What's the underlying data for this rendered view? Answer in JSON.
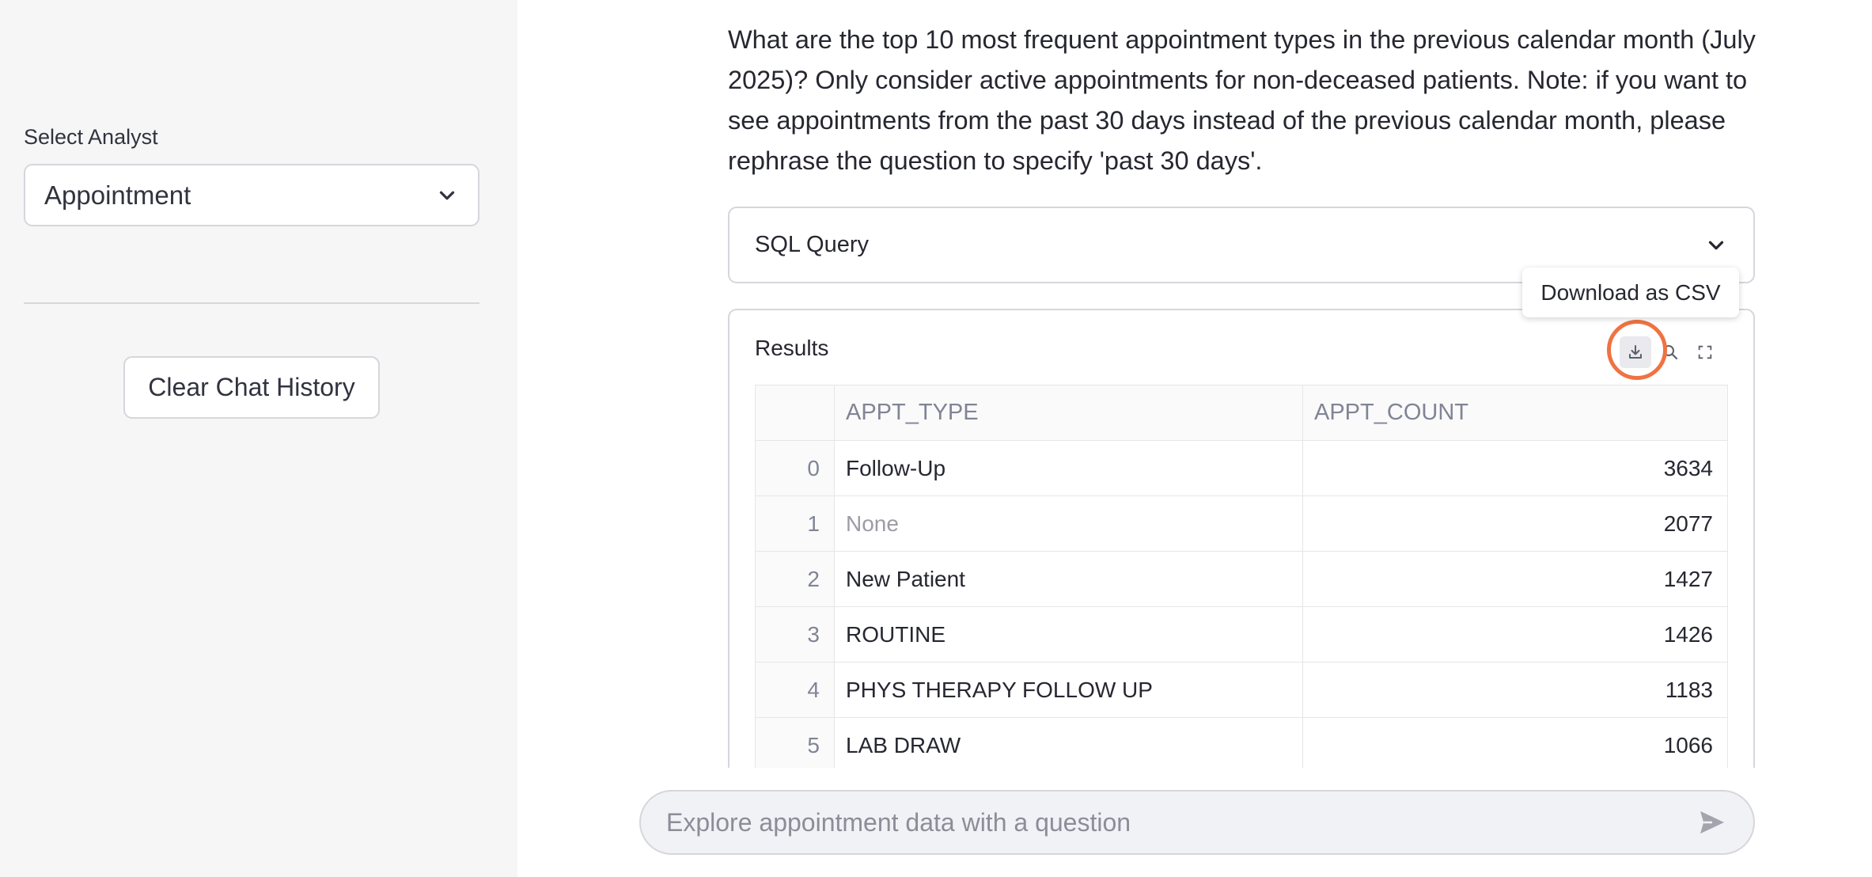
{
  "sidebar": {
    "select_label": "Select Analyst",
    "selected_analyst": "Appointment",
    "clear_button": "Clear Chat History"
  },
  "main": {
    "question": "What are the top 10 most frequent appointment types in the previous calendar month (July 2025)? Only consider active appointments for non-deceased patients. Note: if you want to see appointments from the past 30 days instead of the previous calendar month, please rephrase the question to specify 'past 30 days'.",
    "sql_expander_label": "SQL Query",
    "results_label": "Results",
    "tooltip": "Download as CSV",
    "toolbar_icons": [
      "download-icon",
      "search-icon",
      "fullscreen-icon"
    ],
    "highlight_color": "#f07241",
    "table": {
      "columns": [
        "",
        "APPT_TYPE",
        "APPT_COUNT"
      ],
      "rows": [
        {
          "index": "0",
          "type": "Follow-Up",
          "count": "3634"
        },
        {
          "index": "1",
          "type": "None",
          "count": "2077"
        },
        {
          "index": "2",
          "type": "New Patient",
          "count": "1427"
        },
        {
          "index": "3",
          "type": "ROUTINE",
          "count": "1426"
        },
        {
          "index": "4",
          "type": "PHYS THERAPY FOLLOW UP",
          "count": "1183"
        },
        {
          "index": "5",
          "type": "LAB DRAW",
          "count": "1066"
        }
      ]
    }
  },
  "chat": {
    "placeholder": "Explore appointment data with a question",
    "send_icon": "send-icon"
  }
}
